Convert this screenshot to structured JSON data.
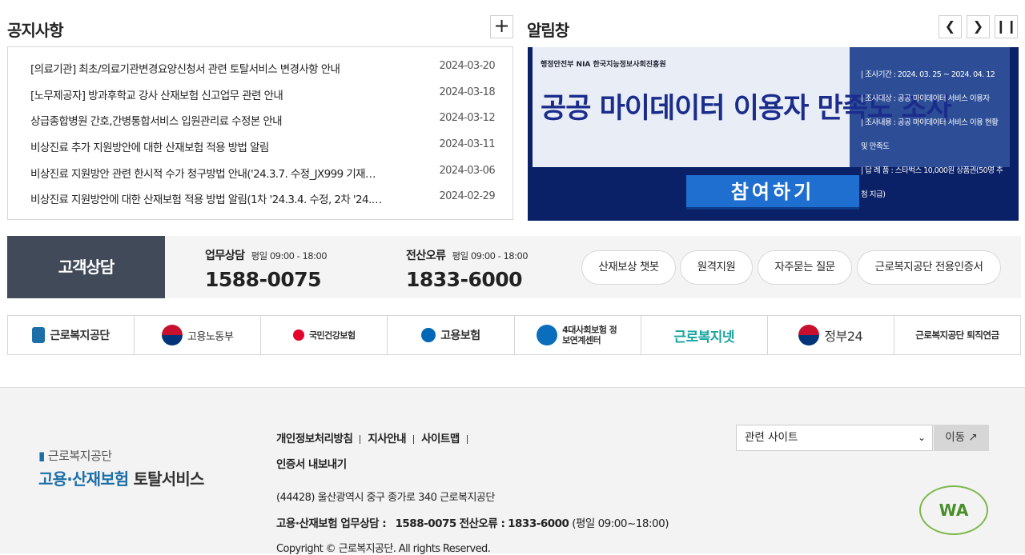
{
  "notice": {
    "title": "공지사항",
    "plus_label": "+",
    "items": [
      {
        "title": "[의료기관] 최초/의료기관변경요양신청서 관련 토탈서비스 변경사항 안내",
        "date": "2024-03-20"
      },
      {
        "title": "[노무제공자] 방과후학교 강사 산재보험 신고업무 관련 안내",
        "date": "2024-03-18"
      },
      {
        "title": "상급종합병원 간호,간병통합서비스 입원관리료 수정본 안내",
        "date": "2024-03-12"
      },
      {
        "title": "비상진료 추가 지원방안에 대한 산재보험 적용 방법 알림",
        "date": "2024-03-11"
      },
      {
        "title": "비상진료 지원방안 관련 한시적 수가 청구방법 안내('24.3.7. 수정_JX999 기재…",
        "date": "2024-03-06"
      },
      {
        "title": "비상진료 지원방안에 대한 산재보험 적용 방법 알림(1차 '24.3.4. 수정, 2차 '24.…",
        "date": "2024-02-29"
      }
    ]
  },
  "alert": {
    "title": "알림창",
    "prev_icon": "chevron-left-icon",
    "next_icon": "chevron-right-icon",
    "pause_icon": "pause-icon",
    "banner": {
      "logos": "행정안전부   NIA 한국지능정보사회진흥원",
      "headline": "공공 마이데이터 이용자 만족도 조사",
      "info": [
        "| 조사기간 : 2024. 03. 25 ~ 2024. 04. 12",
        "| 조사대상 : 공공 마이데이터 서비스 이용자",
        "| 조사내용 : 공공 마이데이터 서비스 이용 현황 및 만족도",
        "| 답 례 품 : 스타벅스 10,000원 상품권(50명 추첨 지급)"
      ],
      "button": "참여하기"
    }
  },
  "customer_service": {
    "label": "고객상담",
    "groups": [
      {
        "name": "업무상담",
        "hours": "평일 09:00 - 18:00",
        "phone": "1588-0075"
      },
      {
        "name": "전산오류",
        "hours": "평일 09:00 - 18:00",
        "phone": "1833-6000"
      }
    ],
    "pills": [
      "산재보상 챗봇",
      "원격지원",
      "자주묻는 질문",
      "근로복지공단 전용인증서"
    ]
  },
  "sites": [
    {
      "label": "근로복지공단",
      "color": "#1d6fa8"
    },
    {
      "label": "고용노동부",
      "color": "#c8102e"
    },
    {
      "label": "국민건강보험",
      "color": "#e4002b"
    },
    {
      "label": "고용보험",
      "color": "#0068b7"
    },
    {
      "label": "4대사회보험 정보연계센터",
      "color": "#0a6ebd"
    },
    {
      "label": "근로복지넷",
      "color": "#1aa5a0"
    },
    {
      "label": "정부24",
      "color": "#003d99"
    },
    {
      "label": "근로복지공단 퇴직연금",
      "color": "#e0702b"
    }
  ],
  "footer": {
    "org": "근로복지공단",
    "service_a": "고용·산재보험",
    "service_b": "토탈서비스",
    "links": [
      "개인정보처리방침",
      "지사안내",
      "사이트맵"
    ],
    "link2": "인증서 내보내기",
    "address": "(44428) 울산광역시 중구 종가로 340 근로복지공단",
    "tel_label": "고용·산재보험 업무상담 :",
    "tel1": "1588-0075",
    "tel2_label": "전산오류 :",
    "tel2": "1833-6000",
    "tel_hours": "(평일 09:00~18:00)",
    "copyright": "Copyright © 근로복지공단. All rights Reserved.",
    "select_value": "관련 사이트",
    "go_label": "이동",
    "wa_mark": "WA"
  }
}
